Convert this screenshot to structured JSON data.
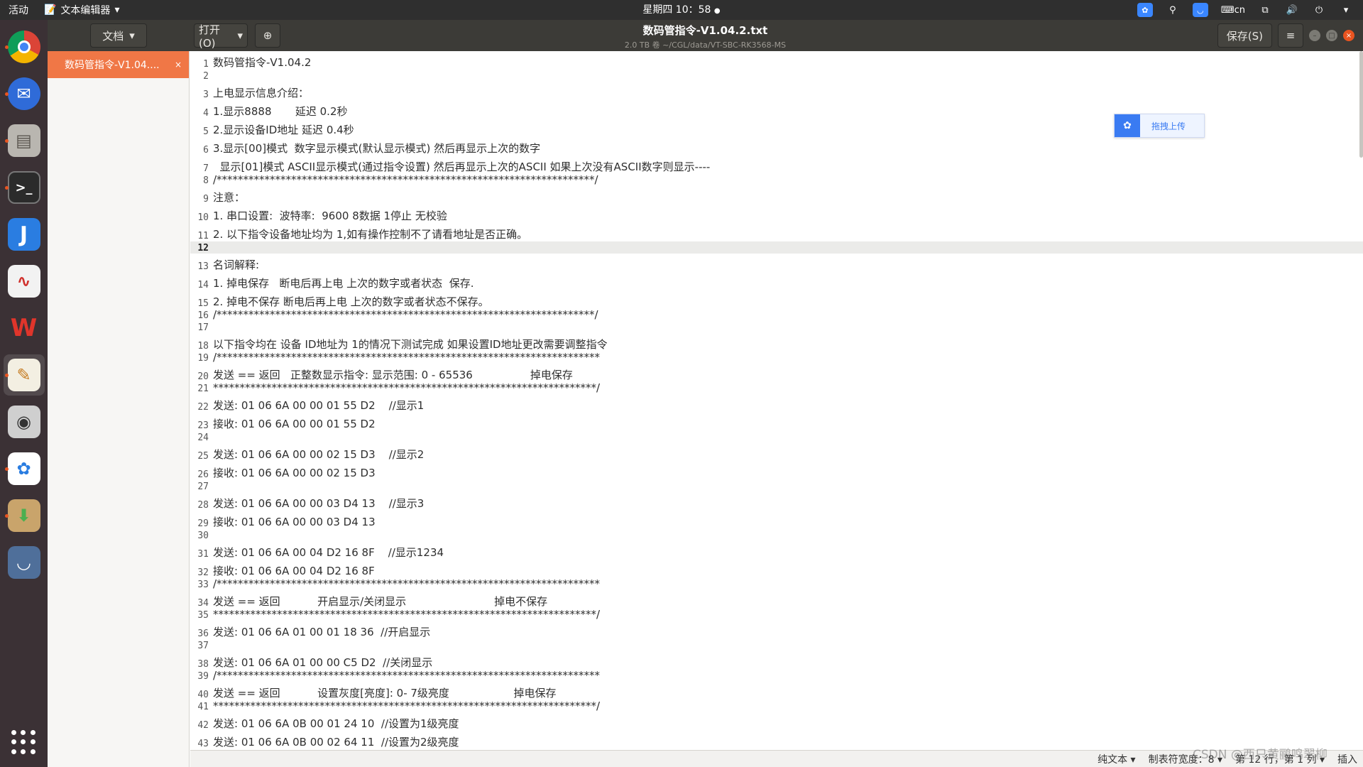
{
  "topbar": {
    "activities": "活动",
    "app_menu": "文本编辑器",
    "clock": "星期四 10：58",
    "tray_lang": "cn"
  },
  "dock": {
    "items": [
      {
        "icon": "chrome-icon",
        "active": false,
        "running": true
      },
      {
        "icon": "mail-client-icon",
        "active": false,
        "running": true
      },
      {
        "icon": "file-manager-icon",
        "active": false,
        "running": true
      },
      {
        "icon": "terminal-icon",
        "active": false,
        "running": true
      },
      {
        "icon": "j-app-icon",
        "active": false,
        "running": false
      },
      {
        "icon": "pdf-reader-icon",
        "active": false,
        "running": false
      },
      {
        "icon": "wps-office-icon",
        "active": false,
        "running": false
      },
      {
        "icon": "text-editor-icon",
        "active": true,
        "running": true
      },
      {
        "icon": "screenshot-camera-icon",
        "active": false,
        "running": false
      },
      {
        "icon": "baidu-netdisk-icon",
        "active": false,
        "running": true
      },
      {
        "icon": "archive-manager-icon",
        "active": false,
        "running": true
      },
      {
        "icon": "monitor-app-icon",
        "active": false,
        "running": false
      }
    ]
  },
  "header": {
    "docs_button": "文档",
    "open_button": "打开(O)",
    "title": "数码管指令-V1.04.2.txt",
    "subtitle": "2.0 TB 卷 ~/CGL/data/VT-SBC-RK3568-MS",
    "save_button": "保存(S)"
  },
  "sidebar": {
    "open_doc": "数码管指令-V1.04....",
    "close_glyph": "×"
  },
  "upload_widget": {
    "label": "拖拽上传"
  },
  "editor": {
    "current_line": 12,
    "lines": [
      {
        "n": "1",
        "text": "数码管指令-V1.04.2"
      },
      {
        "n": "2",
        "text": ""
      },
      {
        "n": "3",
        "text": "上电显示信息介绍："
      },
      {
        "n": "4",
        "text": "1.显示8888       延迟 0.2秒"
      },
      {
        "n": "5",
        "text": "2.显示设备ID地址 延迟 0.4秒"
      },
      {
        "n": "6",
        "text": "3.显示[00]模式  数字显示模式(默认显示模式) 然后再显示上次的数字"
      },
      {
        "n": "7",
        "text": "  显示[01]模式 ASCII显示模式(通过指令设置) 然后再显示上次的ASCII 如果上次没有ASCII数字则显示----"
      },
      {
        "n": "8",
        "text": "/***********************************************************************/"
      },
      {
        "n": "9",
        "text": "注意："
      },
      {
        "n": "10",
        "text": "1. 串口设置:  波特率:  9600 8数据 1停止 无校验"
      },
      {
        "n": "11",
        "text": "2. 以下指令设备地址均为 1,如有操作控制不了请看地址是否正确。"
      },
      {
        "n": "12",
        "text": ""
      },
      {
        "n": "13",
        "text": "名词解释:"
      },
      {
        "n": "14",
        "text": "1. 掉电保存   断电后再上电 上次的数字或者状态  保存."
      },
      {
        "n": "15",
        "text": "2. 掉电不保存 断电后再上电 上次的数字或者状态不保存。"
      },
      {
        "n": "16",
        "text": "/***********************************************************************/"
      },
      {
        "n": "17",
        "text": ""
      },
      {
        "n": "18",
        "text": "以下指令均在 设备 ID地址为 1的情况下测试完成 如果设置ID地址更改需要调整指令"
      },
      {
        "n": "19",
        "text": "/************************************************************************"
      },
      {
        "n": "20",
        "text": "发送 == 返回   正整数显示指令: 显示范围: 0 - 65536                 掉电保存"
      },
      {
        "n": "21",
        "text": "************************************************************************/"
      },
      {
        "n": "22",
        "text": "发送: 01 06 6A 00 00 01 55 D2    //显示1"
      },
      {
        "n": "23",
        "text": "接收: 01 06 6A 00 00 01 55 D2"
      },
      {
        "n": "24",
        "text": ""
      },
      {
        "n": "25",
        "text": "发送: 01 06 6A 00 00 02 15 D3    //显示2"
      },
      {
        "n": "26",
        "text": "接收: 01 06 6A 00 00 02 15 D3"
      },
      {
        "n": "27",
        "text": ""
      },
      {
        "n": "28",
        "text": "发送: 01 06 6A 00 00 03 D4 13    //显示3"
      },
      {
        "n": "29",
        "text": "接收: 01 06 6A 00 00 03 D4 13"
      },
      {
        "n": "30",
        "text": ""
      },
      {
        "n": "31",
        "text": "发送: 01 06 6A 00 04 D2 16 8F    //显示1234"
      },
      {
        "n": "32",
        "text": "接收: 01 06 6A 00 04 D2 16 8F"
      },
      {
        "n": "33",
        "text": "/************************************************************************"
      },
      {
        "n": "34",
        "text": "发送 == 返回           开启显示/关闭显示                          掉电不保存"
      },
      {
        "n": "35",
        "text": "************************************************************************/"
      },
      {
        "n": "36",
        "text": "发送: 01 06 6A 01 00 01 18 36  //开启显示"
      },
      {
        "n": "37",
        "text": ""
      },
      {
        "n": "38",
        "text": "发送: 01 06 6A 01 00 00 C5 D2  //关闭显示"
      },
      {
        "n": "39",
        "text": "/************************************************************************"
      },
      {
        "n": "40",
        "text": "发送 == 返回           设置灰度[亮度]: 0- 7级亮度                   掉电保存"
      },
      {
        "n": "41",
        "text": "************************************************************************/"
      },
      {
        "n": "42",
        "text": "发送: 01 06 6A 0B 00 01 24 10  //设置为1级亮度"
      },
      {
        "n": "43",
        "text": "发送: 01 06 6A 0B 00 02 64 11  //设置为2级亮度"
      }
    ]
  },
  "statusbar": {
    "mode": "纯文本",
    "tab_width": "制表符宽度：8",
    "position": "第 12 行，第 1 列",
    "insert": "插入"
  },
  "watermark": "CSDN @西只黄鹂鸣翠柳"
}
